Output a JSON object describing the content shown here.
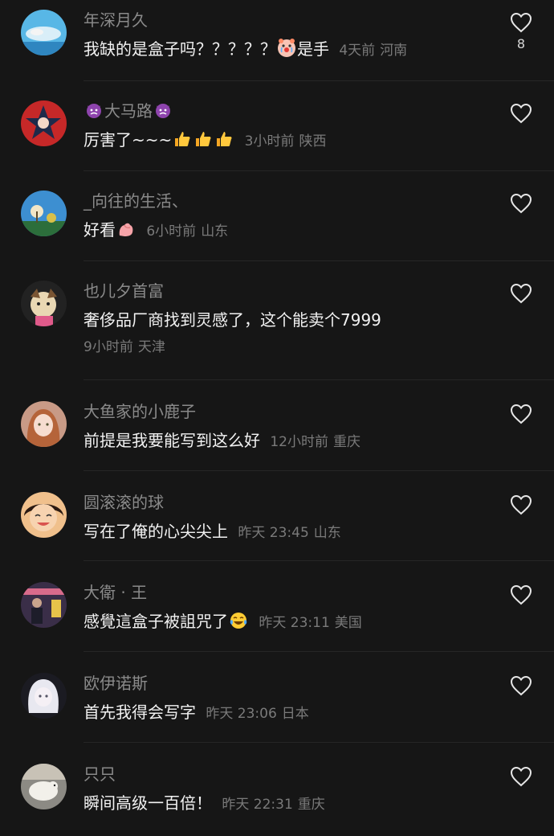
{
  "comments": [
    {
      "username": "年深月久",
      "text": "我缺的是盒子吗？？？？？",
      "emoji_name": "crying-clown-emoji",
      "text_after": "是手",
      "time": "4天前",
      "location": "河南",
      "likes": "8",
      "avatar_color": "#4aa8d8"
    },
    {
      "username_prefix_emoji": "devil-emoji",
      "username": "大马路",
      "username_suffix_emoji": "devil-emoji",
      "text": "厉害了~~~",
      "emoji_name": "thumbs-up-emoji-x3",
      "time": "3小时前",
      "location": "陕西",
      "avatar_color": "#c62828"
    },
    {
      "username": "_向往的生活、",
      "text": "好看",
      "emoji_name": "flexed-biceps-emoji",
      "time": "6小时前",
      "location": "山东",
      "avatar_color": "#3d8fd1"
    },
    {
      "username": "也儿夕首富",
      "text": "奢侈品厂商找到灵感了，这个能卖个7999",
      "time": "9小时前",
      "location": "天津",
      "avatar_color": "#2b2b2b"
    },
    {
      "username": "大鱼家的小鹿子",
      "text": "前提是我要能写到这么好",
      "time": "12小时前",
      "location": "重庆",
      "avatar_color": "#c89a86"
    },
    {
      "username": "圆滚滚的球",
      "text": "写在了俺的心尖尖上",
      "time": "昨天 23:45",
      "location": "山东",
      "avatar_color": "#e2b27c"
    },
    {
      "username": "大衛 · 王",
      "text": "感覺這盒子被詛咒了",
      "emoji_name": "tears-of-joy-emoji",
      "time": "昨天 23:11",
      "location": "美国",
      "avatar_color": "#6a4b6e"
    },
    {
      "username": "欧伊诺斯",
      "text": "首先我得会写字",
      "time": "昨天 23:06",
      "location": "日本",
      "avatar_color": "#d9d9e0"
    },
    {
      "username": "只只",
      "text": "瞬间高级一百倍！",
      "time": "昨天 22:31",
      "location": "重庆",
      "avatar_color": "#b9b2a6"
    }
  ]
}
